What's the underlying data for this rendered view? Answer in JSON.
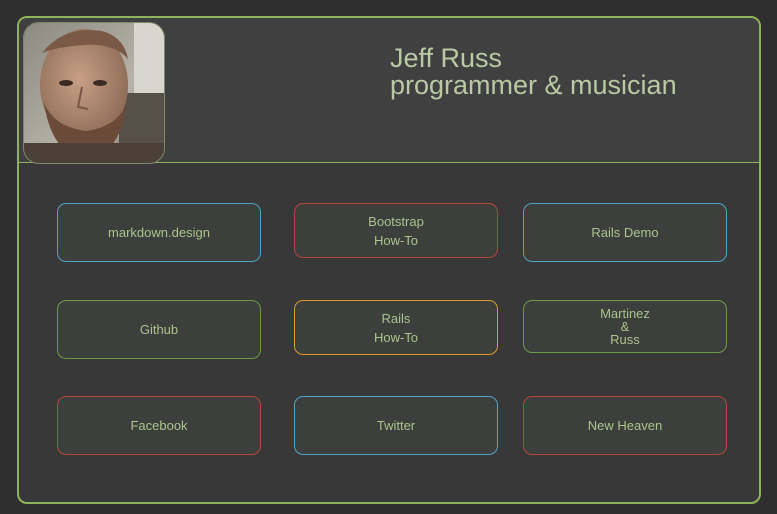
{
  "profile": {
    "name": "Jeff Russ",
    "tagline": "programmer & musician"
  },
  "links": [
    {
      "label": "markdown.design",
      "color": "#4fa3c6"
    },
    {
      "label": "Bootstrap\nHow-To",
      "color": "#b8453a"
    },
    {
      "label": "Rails Demo",
      "color": "#4fa3c6"
    },
    {
      "label": "Github",
      "color": "#6a9c46"
    },
    {
      "label": "Rails\nHow-To",
      "color": "#d89b2e"
    },
    {
      "label": "Martinez\n&\nRuss",
      "color": "#6a9c46"
    },
    {
      "label": "Facebook",
      "color": "#b8453a"
    },
    {
      "label": "Twitter",
      "color": "#4fa3c6"
    },
    {
      "label": "New Heaven",
      "color": "#b8453a"
    }
  ],
  "colors": {
    "accent_border": "#8fb35a",
    "text": "#b9c9a3",
    "button_text": "#a9c48e"
  }
}
